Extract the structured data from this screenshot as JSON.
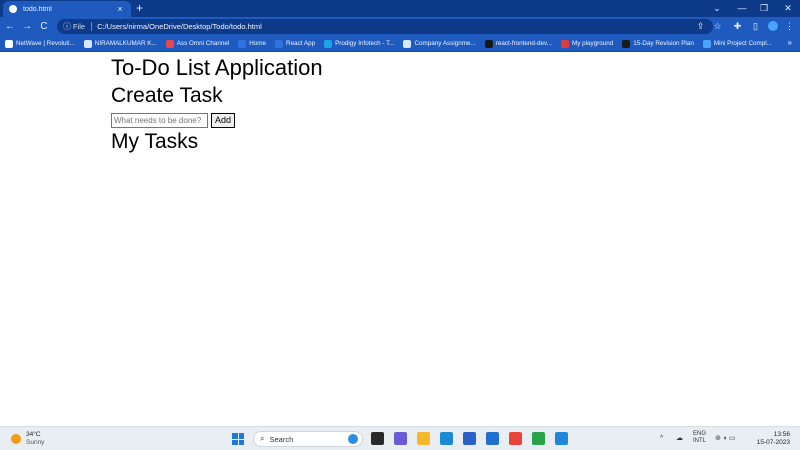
{
  "browser": {
    "tab_title": "todo.html",
    "tab_close": "×",
    "new_tab": "+",
    "window_controls": [
      "⌄",
      "—",
      "❐",
      "✕"
    ],
    "nav": {
      "back": "←",
      "forward": "→",
      "reload": "C"
    },
    "address": {
      "info_glyph": "ⓘ",
      "scheme_label": "File",
      "url": "C:/Users/nirma/OneDrive/Desktop/Todo/todo.html"
    },
    "toolbar_icons": [
      "⇪",
      "☆",
      "✚",
      "▯",
      "⋮"
    ],
    "bookmarks": [
      {
        "label": "NetWave | Revoluti...",
        "color": "#ffffff"
      },
      {
        "label": "NIRAMALKUMAR K...",
        "color": "#d9e6ff"
      },
      {
        "label": "Ass Omni Channel",
        "color": "#e8474b"
      },
      {
        "label": "Home",
        "color": "#2f73e0"
      },
      {
        "label": "React App",
        "color": "#2f73e0"
      },
      {
        "label": "Prodigy Infotech - T...",
        "color": "#1aa6e6"
      },
      {
        "label": "Company Assignme...",
        "color": "#d9e6ff"
      },
      {
        "label": "react-frontend-dev...",
        "color": "#17181a"
      },
      {
        "label": "My playground",
        "color": "#e23b3b"
      },
      {
        "label": "15-Day Revision Plan",
        "color": "#1b1b1b"
      },
      {
        "label": "Mini Project Compl...",
        "color": "#4aa3ff"
      }
    ],
    "bookmarks_more": "»"
  },
  "page": {
    "title": "To-Do List Application",
    "create_heading": "Create Task",
    "input": {
      "placeholder": "What needs to be done?",
      "value": ""
    },
    "add_label": "Add",
    "tasks_heading": "My Tasks"
  },
  "taskbar": {
    "weather": {
      "temp": "34°C",
      "desc": "Sunny"
    },
    "search_label": "Search",
    "search_glyph": "⌕",
    "apps": [
      {
        "name": "task-view",
        "color": "#2a2a2a"
      },
      {
        "name": "teams",
        "color": "#6b5ad6"
      },
      {
        "name": "file-explorer",
        "color": "#f5b82a"
      },
      {
        "name": "edge",
        "color": "#1b8ad6"
      },
      {
        "name": "store",
        "color": "#2a62c9"
      },
      {
        "name": "mail",
        "color": "#1e6fd0"
      },
      {
        "name": "anydesk",
        "color": "#e8443a"
      },
      {
        "name": "chrome",
        "color": "#2aa24a"
      },
      {
        "name": "vscode",
        "color": "#1f87d9"
      }
    ],
    "tray": {
      "chevron": "^",
      "lang_1": "ENG",
      "lang_2": "INTL",
      "icons": "⊚ ◖ ▭"
    },
    "clock": {
      "time": "13:56",
      "date": "15-07-2023"
    }
  }
}
